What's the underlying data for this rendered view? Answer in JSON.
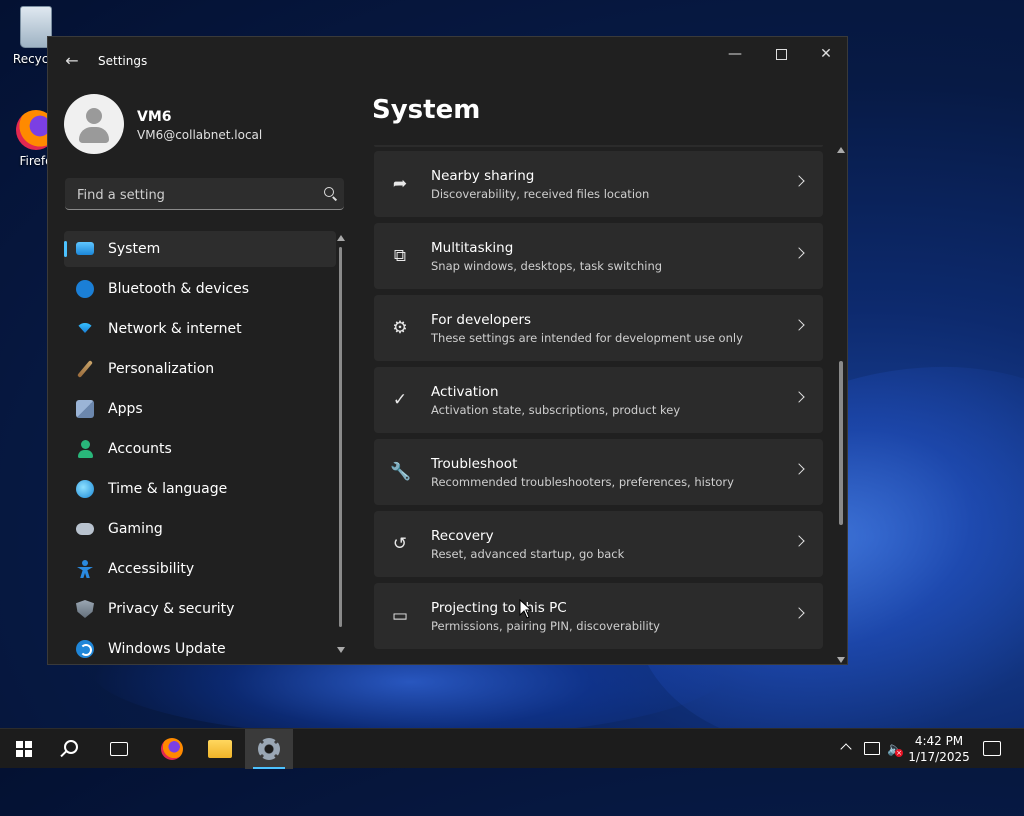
{
  "desktop": {
    "icons": [
      {
        "label": "Recycle",
        "icon": "recycle-bin-icon"
      },
      {
        "label": "Firefo",
        "icon": "firefox-icon"
      }
    ]
  },
  "window": {
    "title": "Settings",
    "back_icon": "back-arrow-icon",
    "controls": [
      "minimize",
      "maximize",
      "close"
    ]
  },
  "profile": {
    "name": "VM6",
    "email": "VM6@collabnet.local"
  },
  "search": {
    "placeholder": "Find a setting",
    "value": ""
  },
  "sidebar": {
    "items": [
      {
        "label": "System",
        "icon": "system-icon",
        "active": true
      },
      {
        "label": "Bluetooth & devices",
        "icon": "bluetooth-icon"
      },
      {
        "label": "Network & internet",
        "icon": "wifi-icon"
      },
      {
        "label": "Personalization",
        "icon": "brush-icon"
      },
      {
        "label": "Apps",
        "icon": "apps-icon"
      },
      {
        "label": "Accounts",
        "icon": "accounts-icon"
      },
      {
        "label": "Time & language",
        "icon": "globe-clock-icon"
      },
      {
        "label": "Gaming",
        "icon": "gamepad-icon"
      },
      {
        "label": "Accessibility",
        "icon": "accessibility-icon"
      },
      {
        "label": "Privacy & security",
        "icon": "shield-icon"
      },
      {
        "label": "Windows Update",
        "icon": "update-icon"
      }
    ]
  },
  "main": {
    "title": "System",
    "cards": [
      {
        "title": "Nearby sharing",
        "subtitle": "Discoverability, received files location",
        "icon": "share-icon"
      },
      {
        "title": "Multitasking",
        "subtitle": "Snap windows, desktops, task switching",
        "icon": "multitasking-icon"
      },
      {
        "title": "For developers",
        "subtitle": "These settings are intended for development use only",
        "icon": "developer-tools-icon"
      },
      {
        "title": "Activation",
        "subtitle": "Activation state, subscriptions, product key",
        "icon": "checkmark-circle-icon"
      },
      {
        "title": "Troubleshoot",
        "subtitle": "Recommended troubleshooters, preferences, history",
        "icon": "wrench-icon"
      },
      {
        "title": "Recovery",
        "subtitle": "Reset, advanced startup, go back",
        "icon": "recovery-icon"
      },
      {
        "title": "Projecting to this PC",
        "subtitle": "Permissions, pairing PIN, discoverability",
        "icon": "projecting-icon"
      }
    ]
  },
  "taskbar": {
    "apps": [
      "start",
      "search",
      "task-view",
      "firefox",
      "file-explorer",
      "settings"
    ],
    "active_app": "settings",
    "clock": {
      "time": "4:42 PM",
      "date": "1/17/2025"
    }
  },
  "colors": {
    "accent": "#4cc2ff",
    "window_bg": "#202020",
    "card_bg": "#2b2b2b"
  }
}
